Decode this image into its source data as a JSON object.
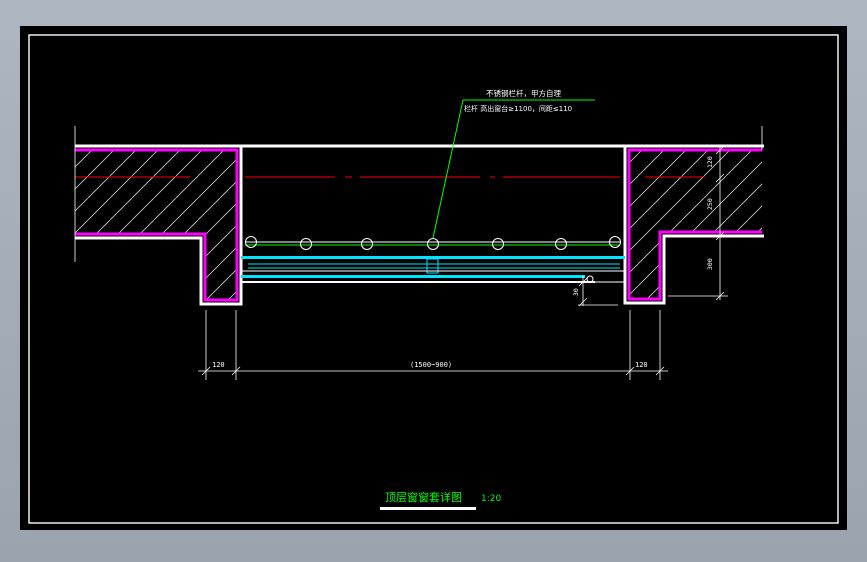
{
  "drawing": {
    "title": "顶层窗窗套详图",
    "scale": "1:20",
    "note_line_1": "不锈钢栏杆，甲方自理",
    "note_line_2": "栏杆 高出窗台≥1100，间距≤110"
  },
  "dimensions": {
    "wall_left": "120",
    "opening": "(1500~900)",
    "wall_right": "120",
    "sill_gap": "30",
    "right_v1": "120",
    "right_v2": "250",
    "right_v3": "300"
  },
  "colors": {
    "background": "#000000",
    "frame": "#ffffff",
    "wall_outline": "#ff00ff",
    "window": "#00e5ff",
    "leader": "#00ff00",
    "axis": "#ff0000",
    "text": "#ffffff",
    "title": "#00ff00"
  }
}
